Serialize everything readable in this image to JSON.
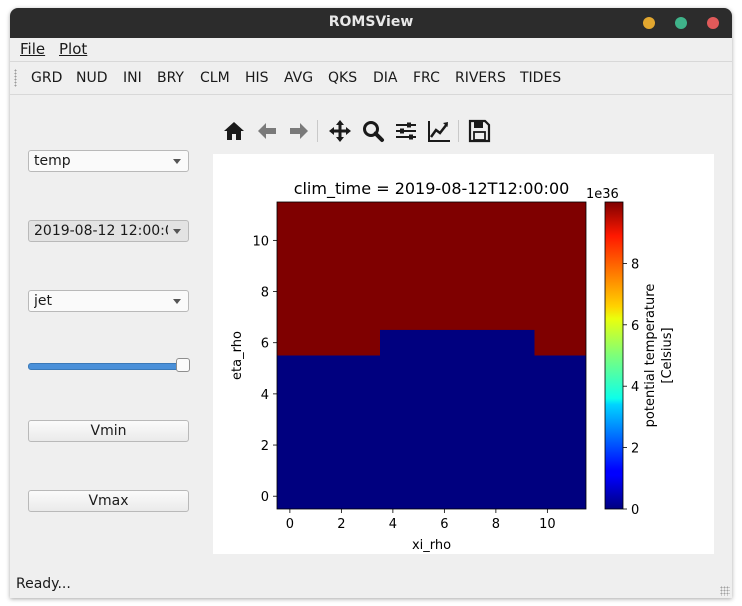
{
  "window": {
    "title": "ROMSView"
  },
  "menu": [
    {
      "label": "File"
    },
    {
      "label": "Plot"
    }
  ],
  "toolbar": {
    "items": [
      "GRD",
      "NUD",
      "INI",
      "BRY",
      "CLM",
      "HIS",
      "AVG",
      "QKS",
      "DIA",
      "FRC",
      "RIVERS",
      "TIDES"
    ]
  },
  "controls": {
    "variable": "temp",
    "time": "2019-08-12 12:00:00",
    "colormap": "jet",
    "slider_fraction": 1.0,
    "vmin_label": "Vmin",
    "vmax_label": "Vmax"
  },
  "navbar_icons": [
    "home-icon",
    "back-icon",
    "forward-icon",
    "pan-icon",
    "zoom-icon",
    "configure-subplots-icon",
    "edit-axes-icon",
    "save-icon"
  ],
  "status": "Ready...",
  "chart_data": {
    "type": "heatmap",
    "title": "clim_time = 2019-08-12T12:00:00",
    "xlabel": "xi_rho",
    "ylabel": "eta_rho",
    "xlim": [
      -0.5,
      11.5
    ],
    "ylim": [
      -0.5,
      11.5
    ],
    "xticks": [
      0,
      2,
      4,
      6,
      8,
      10
    ],
    "yticks": [
      0,
      2,
      4,
      6,
      8,
      10
    ],
    "grid": false,
    "colormap": "jet",
    "low_value": 0,
    "high_value": 1e+37,
    "low_region": [
      {
        "x0": -0.5,
        "x1": 11.5,
        "y0": -0.5,
        "y1": 5.5
      },
      {
        "x0": 3.5,
        "x1": 9.5,
        "y0": 5.5,
        "y1": 6.5
      }
    ],
    "colorbar": {
      "label_line1": "potential temperature",
      "label_line2": "[Celsius]",
      "ticks": [
        0,
        2,
        4,
        6,
        8
      ],
      "tick_labels": [
        "0",
        "2",
        "4",
        "6",
        "8"
      ],
      "range": [
        0,
        10
      ],
      "offset_text": "1e36"
    },
    "colors": {
      "low": "#00007f",
      "high": "#7f0000"
    }
  }
}
